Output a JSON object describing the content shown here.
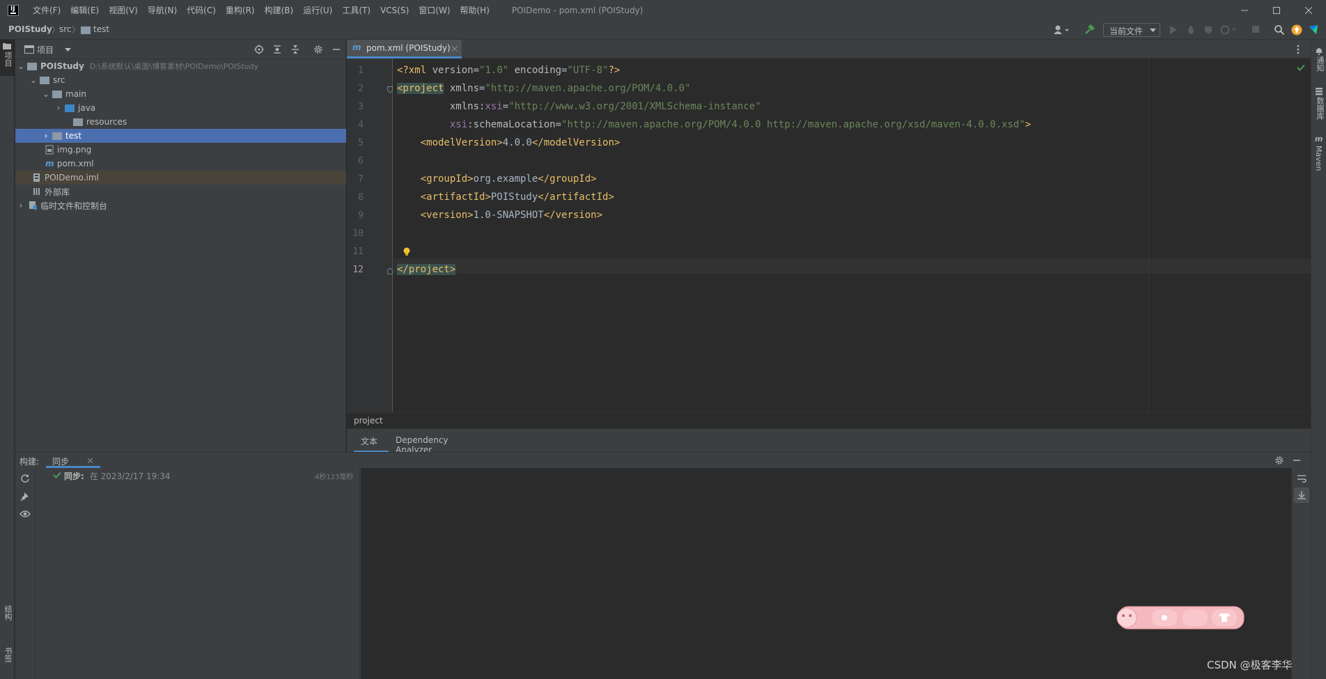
{
  "menu": {
    "items": [
      "文件(F)",
      "编辑(E)",
      "视图(V)",
      "导航(N)",
      "代码(C)",
      "重构(R)",
      "构建(B)",
      "运行(U)",
      "工具(T)",
      "VCS(S)",
      "窗口(W)",
      "帮助(H)"
    ],
    "window_title": "POIDemo - pom.xml (POIStudy)"
  },
  "breadcrumb": {
    "root": "POIStudy",
    "src": "src",
    "test": "test"
  },
  "toolbar": {
    "run_config": "当前文件"
  },
  "left_strip": {
    "project": "项目",
    "structure": "结构",
    "bookmarks": "书签"
  },
  "right_strip": {
    "notifications": "通知",
    "database": "数据库",
    "maven": "Maven"
  },
  "project_panel": {
    "title": "项目",
    "root_name": "POIStudy",
    "root_path": "D:\\系统默认\\桌面\\博客素材\\POIDemo\\POIStudy",
    "src": "src",
    "main": "main",
    "java": "java",
    "resources": "resources",
    "test": "test",
    "img": "img.png",
    "pom": "pom.xml",
    "iml": "POIDemo.iml",
    "ext_libs": "外部库",
    "scratches": "临时文件和控制台"
  },
  "editor": {
    "tab_label": "pom.xml (POIStudy)",
    "line_numbers": [
      "1",
      "2",
      "3",
      "4",
      "5",
      "6",
      "7",
      "8",
      "9",
      "10",
      "11",
      "12"
    ],
    "l1": {
      "a": "<?xml ",
      "b": "version",
      "c": "=",
      "d": "\"1.0\"",
      "e": " encoding",
      "f": "=",
      "g": "\"UTF-8\"",
      "h": "?>"
    },
    "l2": {
      "a": "<project",
      "b": " xmlns",
      "c": "=",
      "d": "\"http://maven.apache.org/POM/4.0.0\""
    },
    "l3": {
      "a": "         xmlns",
      "b": ":",
      "c": "xsi",
      "d": "=",
      "e": "\"http://www.w3.org/2001/XMLSchema-instance\""
    },
    "l4": {
      "a": "         xsi",
      "b": ":schemaLocation",
      "c": "=",
      "d": "\"http://maven.apache.org/POM/4.0.0 http://maven.apache.org/xsd/maven-4.0.0.xsd\"",
      "e": ">"
    },
    "l5": {
      "a": "    <modelVersion>",
      "b": "4.0.0",
      "c": "</modelVersion>"
    },
    "l7": {
      "a": "    <groupId>",
      "b": "org.example",
      "c": "</groupId>"
    },
    "l8": {
      "a": "    <artifactId>",
      "b": "POIStudy",
      "c": "</artifactId>"
    },
    "l9": {
      "a": "    <version>",
      "b": "1.0-SNAPSHOT",
      "c": "</version>"
    },
    "l12": {
      "a": "</project>"
    },
    "structure_crumb": "project",
    "bottom_tab_text": "文本",
    "bottom_tab_dependency": "Dependency Analyzer"
  },
  "build": {
    "label": "构建:",
    "tab": "同步",
    "sync_label": "同步:",
    "sync_text": " 在 2023/2/17 19:34",
    "sync_time": "4秒123毫秒"
  },
  "watermark": "CSDN @极客李华",
  "colors": {
    "selection": "#4b6eaf",
    "iml_row": "#49443a",
    "accent_green": "#499c54"
  }
}
